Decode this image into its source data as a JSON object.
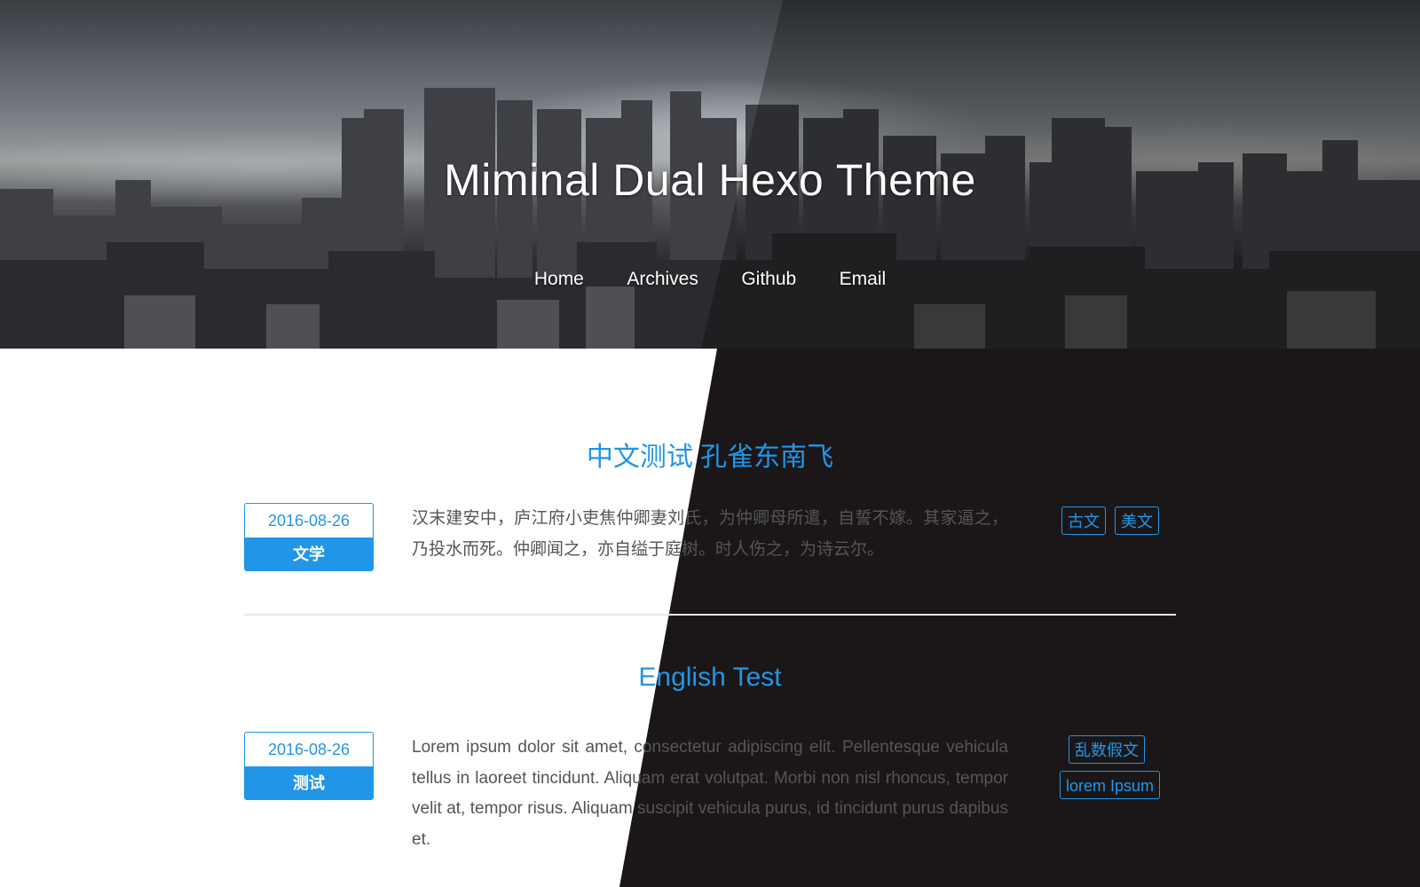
{
  "site": {
    "title": "Miminal Dual Hexo Theme"
  },
  "nav": {
    "items": [
      {
        "label": "Home"
      },
      {
        "label": "Archives"
      },
      {
        "label": "Github"
      },
      {
        "label": "Email"
      }
    ]
  },
  "posts": [
    {
      "title": "中文测试 孔雀东南飞",
      "date": "2016-08-26",
      "category": "文学",
      "excerpt": "汉末建安中，庐江府小吏焦仲卿妻刘氏，为仲卿母所遣，自誓不嫁。其家逼之，乃投水而死。仲卿闻之，亦自缢于庭树。时人伤之，为诗云尔。",
      "tags": [
        "古文",
        "美文"
      ]
    },
    {
      "title": "English Test",
      "date": "2016-08-26",
      "category": "测试",
      "excerpt": "Lorem ipsum dolor sit amet, consectetur adipiscing elit. Pellentesque vehicula tellus in laoreet tincidunt. Aliquam erat volutpat. Morbi non nisl rhoncus, tempor velit at, tempor risus. Aliquam suscipit vehicula purus, id tincidunt purus dapibus et.",
      "tags": [
        "乱数假文",
        "lorem Ipsum"
      ]
    }
  ],
  "colors": {
    "accent": "#2196e8",
    "dark_background": "#1b1718",
    "light_background": "#ffffff",
    "light_text": "#555555",
    "dark_text": "#ffffff"
  }
}
